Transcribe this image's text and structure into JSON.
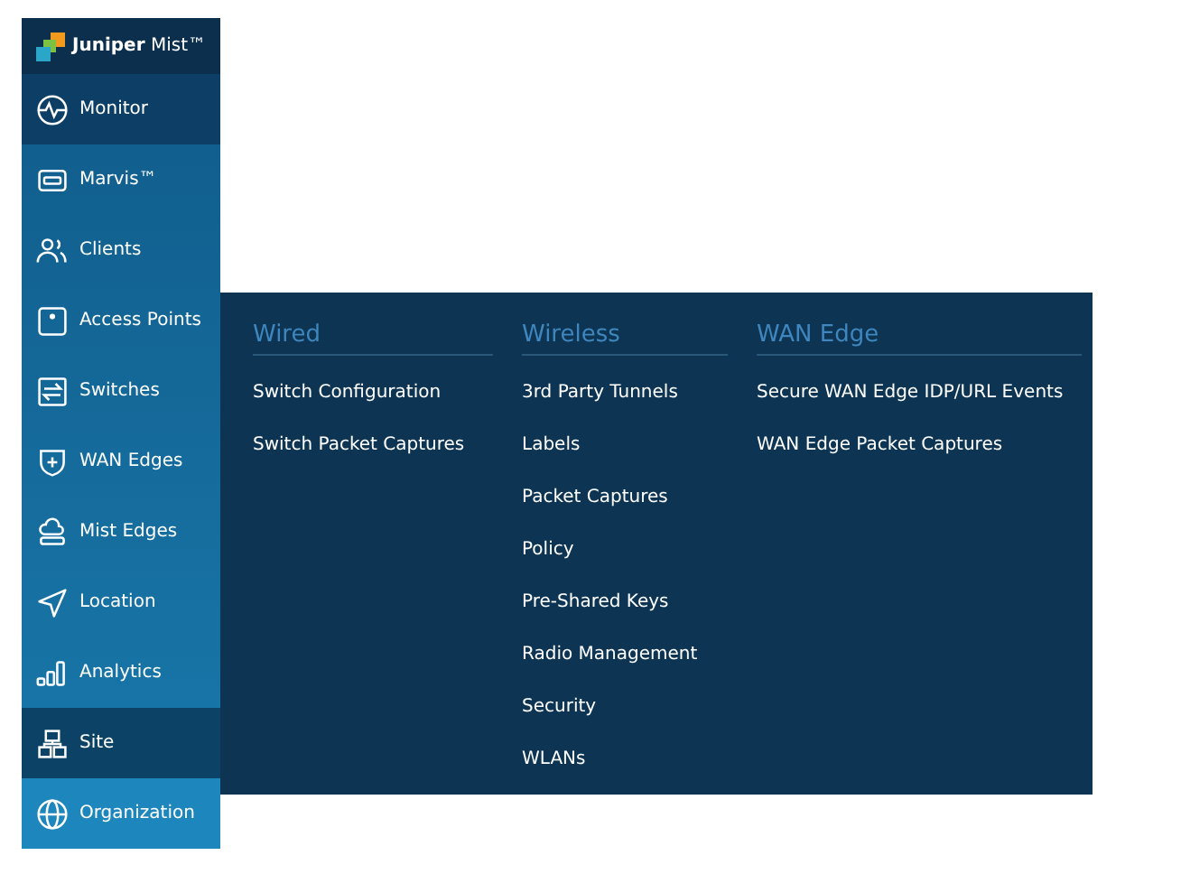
{
  "logo": {
    "name": "Juniper",
    "suffix": "Mist™"
  },
  "sidebar": {
    "items": [
      {
        "label": "Monitor",
        "kind": "current"
      },
      {
        "label": "Marvis™",
        "kind": "normal"
      },
      {
        "label": "Clients",
        "kind": "normal"
      },
      {
        "label": "Access Points",
        "kind": "normal"
      },
      {
        "label": "Switches",
        "kind": "normal"
      },
      {
        "label": "WAN Edges",
        "kind": "normal"
      },
      {
        "label": "Mist Edges",
        "kind": "normal"
      },
      {
        "label": "Location",
        "kind": "normal"
      },
      {
        "label": "Analytics",
        "kind": "normal"
      },
      {
        "label": "Site",
        "kind": "selected"
      },
      {
        "label": "Organization",
        "kind": "light"
      }
    ]
  },
  "flyout": {
    "columns": [
      {
        "heading": "Wired",
        "items": [
          "Switch Configuration",
          "Switch Packet Captures"
        ]
      },
      {
        "heading": "Wireless",
        "items": [
          "3rd Party Tunnels",
          "Labels",
          "Packet Captures",
          "Policy",
          "Pre-Shared Keys",
          "Radio Management",
          "Security",
          "WLANs"
        ]
      },
      {
        "heading": "WAN Edge",
        "items": [
          "Secure WAN Edge IDP/URL Events",
          "WAN Edge Packet Captures"
        ]
      }
    ]
  }
}
